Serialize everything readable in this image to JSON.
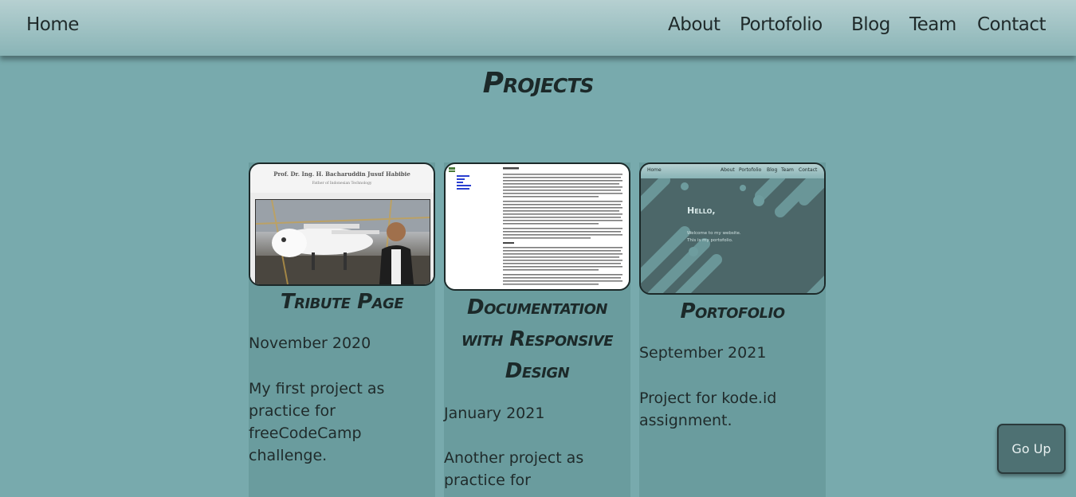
{
  "nav": {
    "home": "Home",
    "links": [
      "About",
      "Portofolio",
      "Blog",
      "Team",
      "Contact"
    ]
  },
  "page_title": "Projects",
  "projects": [
    {
      "title": "Tribute Page",
      "date": "November 2020",
      "description": "My first project as practice for freeCodeCamp challenge.",
      "thumb": {
        "heading": "Prof. Dr. Ing. H. Bacharuddin Jusuf Habibie",
        "subheading": "Father of Indonesian Technology"
      }
    },
    {
      "title": "Documentation with Responsive Design",
      "date": "January 2021",
      "description": "Another project as practice for"
    },
    {
      "title": "Portofolio",
      "date": "September 2021",
      "description": "Project for kode.id assignment.",
      "thumb": {
        "nav_home": "Home",
        "nav_links": [
          "About",
          "Portofolio",
          "Blog",
          "Team",
          "Contact"
        ],
        "hello": "Hello,",
        "line1": "Welcome to my website.",
        "line2": "This is my portofolio."
      }
    }
  ],
  "go_up": "Go Up",
  "colors": {
    "background": "#78aaad",
    "card": "#6a9c9e",
    "button": "#4e7173"
  }
}
